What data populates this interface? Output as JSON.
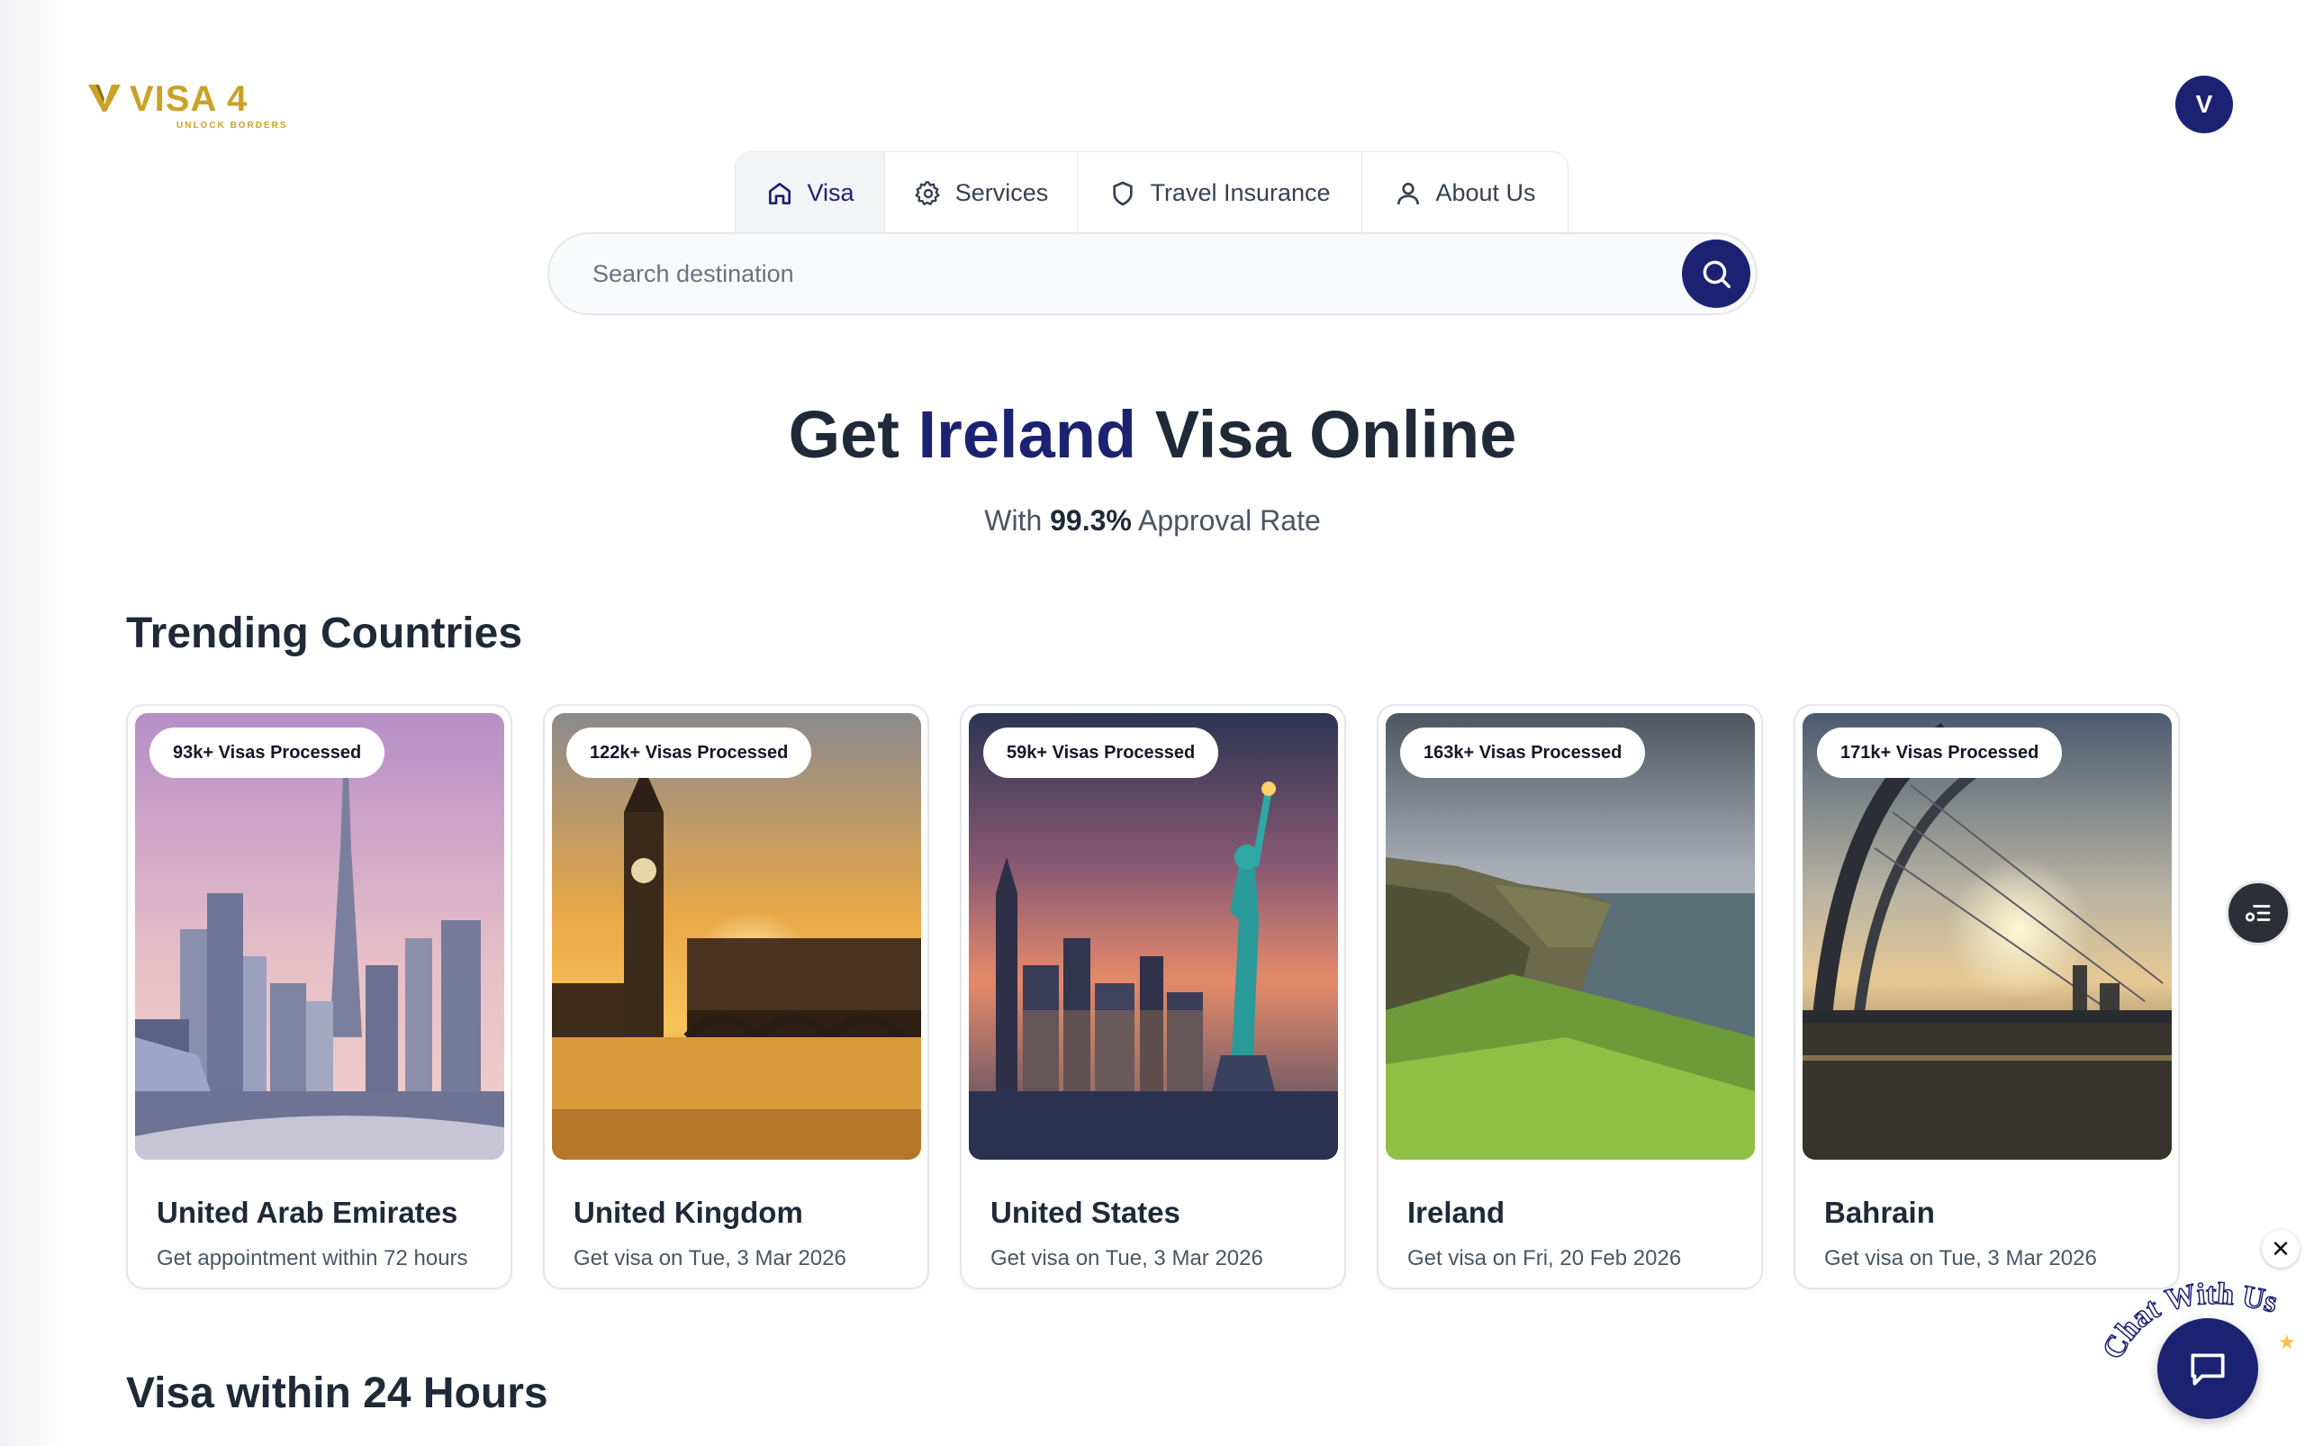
{
  "brand": {
    "logo_text": "VISA 4",
    "tagline": "UNLOCK BORDERS",
    "color": "#c9a227"
  },
  "user": {
    "avatar_initial": "V"
  },
  "nav": {
    "tabs": [
      {
        "label": "Visa",
        "icon": "home-icon",
        "active": true
      },
      {
        "label": "Services",
        "icon": "gear-icon",
        "active": false
      },
      {
        "label": "Travel Insurance",
        "icon": "shield-icon",
        "active": false
      },
      {
        "label": "About Us",
        "icon": "user-icon",
        "active": false
      }
    ]
  },
  "search": {
    "placeholder": "Search destination",
    "value": ""
  },
  "hero": {
    "prefix": "Get",
    "country": "Ireland",
    "suffix": "Visa Online",
    "sub_prefix": "With",
    "rate": "99.3%",
    "sub_suffix": "Approval Rate"
  },
  "trending": {
    "title": "Trending Countries",
    "cards": [
      {
        "badge": "93k+ Visas Processed",
        "name": "United Arab Emirates",
        "subtitle": "Get appointment within 72 hours",
        "scene": "dubai-skyline"
      },
      {
        "badge": "122k+ Visas Processed",
        "name": "United Kingdom",
        "subtitle": "Get visa on Tue, 3 Mar 2026",
        "scene": "big-ben-sunset"
      },
      {
        "badge": "59k+ Visas Processed",
        "name": "United States",
        "subtitle": "Get visa on Tue, 3 Mar 2026",
        "scene": "statue-of-liberty"
      },
      {
        "badge": "163k+ Visas Processed",
        "name": "Ireland",
        "subtitle": "Get visa on Fri, 20 Feb 2026",
        "scene": "cliffs-of-moher"
      },
      {
        "badge": "171k+ Visas Processed",
        "name": "Bahrain",
        "subtitle": "Get visa on Tue, 3 Mar 2026",
        "scene": "bridge-sunset"
      }
    ]
  },
  "visa24": {
    "title": "Visa within 24 Hours"
  },
  "chat": {
    "label": "Chat With Us"
  },
  "colors": {
    "primary": "#1b2272",
    "text": "#1f2937",
    "muted": "#4b5563"
  }
}
